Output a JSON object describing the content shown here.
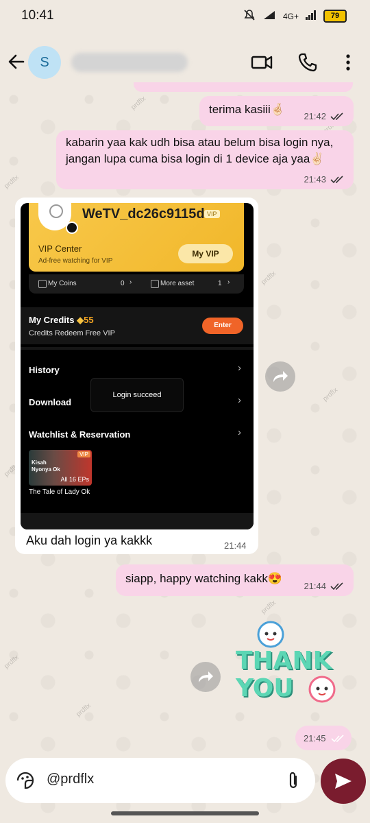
{
  "status_bar": {
    "time": "10:41",
    "network": "4G+",
    "battery": "79"
  },
  "header": {
    "avatar_initial": "S"
  },
  "messages": [
    {
      "dir": "out",
      "text": "terima kasiii🤞🏻",
      "time": "21:42"
    },
    {
      "dir": "out",
      "text": "kabarin yaa kak udh bisa atau belum bisa login nya, jangan lupa cuma bisa login di 1 device aja yaa✌🏻",
      "time": "21:43"
    },
    {
      "dir": "in",
      "caption": "Aku dah login ya kakkk",
      "time": "21:44"
    },
    {
      "dir": "out",
      "text": "siapp, happy watching kakk😍",
      "time": "21:44"
    },
    {
      "dir": "out",
      "type": "sticker",
      "text": "THANK YOU",
      "time": "21:45"
    }
  ],
  "screenshot": {
    "username": "WeTV_dc26c9115d",
    "vip_badge": "VIP",
    "vip_center": "VIP Center",
    "vip_sub": "Ad-free watching for VIP",
    "my_vip": "My VIP",
    "coins_label": "My Coins",
    "coins_value": "0",
    "asset_label": "More asset",
    "asset_value": "1",
    "credits_label": "My Credits",
    "credits_value": "55",
    "credits_sub": "Credits Redeem Free VIP",
    "enter": "Enter",
    "menu": [
      "History",
      "Download",
      "Watchlist & Reservation"
    ],
    "toast": "Login succeed",
    "thumb_title_line1": "Kisah",
    "thumb_title_line2": "Nyonya Ok",
    "thumb_vip": "VIP",
    "thumb_eps": "All 16 EPs",
    "thumb_caption": "The Tale of Lady Ok"
  },
  "input": {
    "text": "@prdflx"
  },
  "watermark": "prdflx",
  "colors": {
    "outgoing": "#f9d4e8",
    "incoming": "#ffffff",
    "send": "#7a1c2e",
    "read_ticks": "#555555"
  }
}
